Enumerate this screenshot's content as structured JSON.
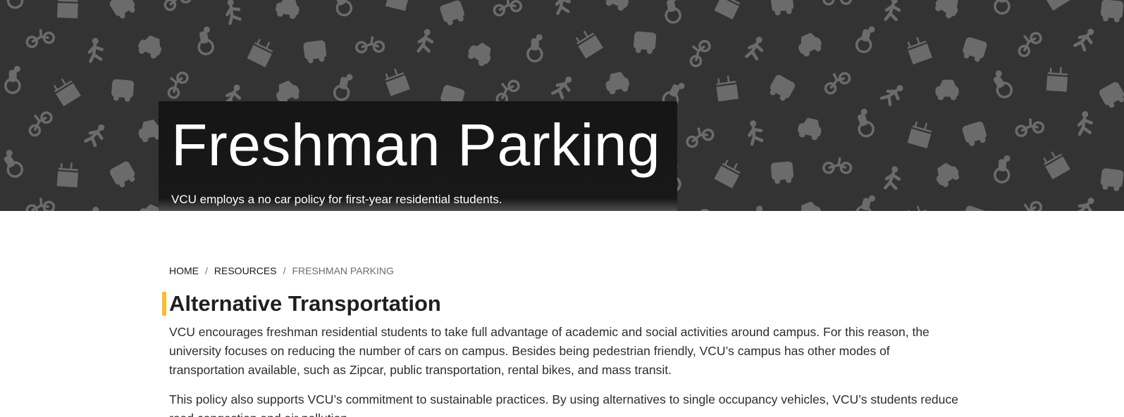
{
  "hero": {
    "title": "Freshman Parking",
    "subtitle": "VCU employs a no car policy for first-year residential students.",
    "pattern_color": "#6b6b6b",
    "background_color": "#333333",
    "pattern_icons": [
      "car-icon",
      "bicycle-icon",
      "pedestrian-icon",
      "bus-icon",
      "building-icon"
    ]
  },
  "breadcrumb": {
    "items": [
      {
        "label": "HOME"
      },
      {
        "label": "RESOURCES"
      }
    ],
    "current": "FRESHMAN PARKING",
    "separator": "/"
  },
  "section": {
    "heading": "Alternative Transportation",
    "accent_color": "#fdbb30",
    "paragraphs": [
      "VCU encourages freshman residential students to take full advantage of academic and social activities around campus. For this reason, the university focuses on reducing the number of cars on campus. Besides being pedestrian friendly, VCU’s campus has other modes of transportation available, such as Zipcar, public transportation, rental bikes, and mass transit.",
      "This policy also supports VCU’s commitment to sustainable practices. By using alternatives to single occupancy vehicles, VCU’s students reduce road congestion and air pollution."
    ]
  }
}
